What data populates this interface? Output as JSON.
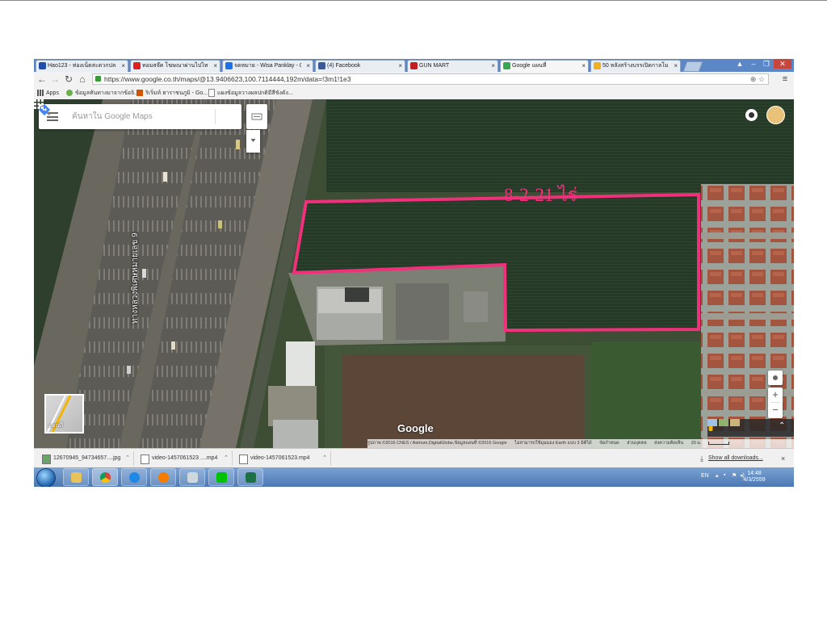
{
  "browser": {
    "tabs": [
      {
        "label": "Hao123 - ท่องเน็ตสะดวกปลอ",
        "favicon_color": "#1f4fa8",
        "active": false
      },
      {
        "label": "ทอมสจ๊ค โฆษณาผ่านไปไหนที่ อ",
        "favicon_color": "#e02020",
        "active": false
      },
      {
        "label": "จดหมาย - Wisa Panklay - O",
        "favicon_color": "#1a73e8",
        "active": false
      },
      {
        "label": "(4) Facebook",
        "favicon_color": "#3b5998",
        "active": false
      },
      {
        "label": "GUN MART",
        "favicon_color": "#c02020",
        "active": false
      },
      {
        "label": "Google แผนที่",
        "favicon_color": "#34a853",
        "active": true
      },
      {
        "label": "50 หลังสร้างบรรเปิดกาลโมยอ",
        "favicon_color": "#f0b020",
        "active": false
      }
    ],
    "tab_close": "×",
    "address": "https://www.google.co.th/maps/@13.9406623,100.7114444,192m/data=!3m1!1e3",
    "bookmarks": [
      {
        "label": "Apps",
        "color": "#555555"
      },
      {
        "label": "ข้อมูลทันทางมาจากข้อจิ...",
        "color": "#6ab04c"
      },
      {
        "label": "ริเริ่มท์ ฮาราชนภูมิ - Go...",
        "color": "#d35400"
      },
      {
        "label": "แผงข้อมูลวางผลปกติมีสีขังดัง...",
        "color": "#888888"
      }
    ]
  },
  "map": {
    "search_placeholder": "ค้นหาใน Google Maps",
    "plot_label": "8-2-21 ไร่",
    "road_name": "ทางหลวงพิเศษหมายเลข 9",
    "logo": "Google",
    "earth_label": "แผนที่",
    "attribution": [
      "รูปภาพ ©2016 CNES / Astrium,DigitalGlobe,ข้อมูลแผนที่ ©2016 Google",
      "ไม่สามารถใช้มุมมอง Earth แบบ 3 มิติได้",
      "ข้อกำหนด",
      "ส่วนบุคคล",
      "ส่งความคิดเห็น",
      "20 ม."
    ],
    "zoom_in": "+",
    "zoom_out": "−",
    "plot_color": "#f0307a"
  },
  "downloads": {
    "items": [
      {
        "label": "12670945_94734657....jpg"
      },
      {
        "label": "video-1457061523 ....mp4"
      },
      {
        "label": "video-1457061523.mp4"
      }
    ],
    "show_all": "Show all downloads...",
    "close": "×"
  },
  "taskbar": {
    "apps": [
      {
        "name": "explorer",
        "color": "#e8c25a"
      },
      {
        "name": "chrome",
        "color": "#db4437"
      },
      {
        "name": "internet-explorer",
        "color": "#1e88e5"
      },
      {
        "name": "media-player",
        "color": "#f57c00"
      },
      {
        "name": "notepad",
        "color": "#90a4ae"
      },
      {
        "name": "line",
        "color": "#00c300"
      },
      {
        "name": "excel",
        "color": "#1e7145"
      }
    ],
    "lang": "EN",
    "time": "14:48",
    "date": "4/3/2559"
  }
}
